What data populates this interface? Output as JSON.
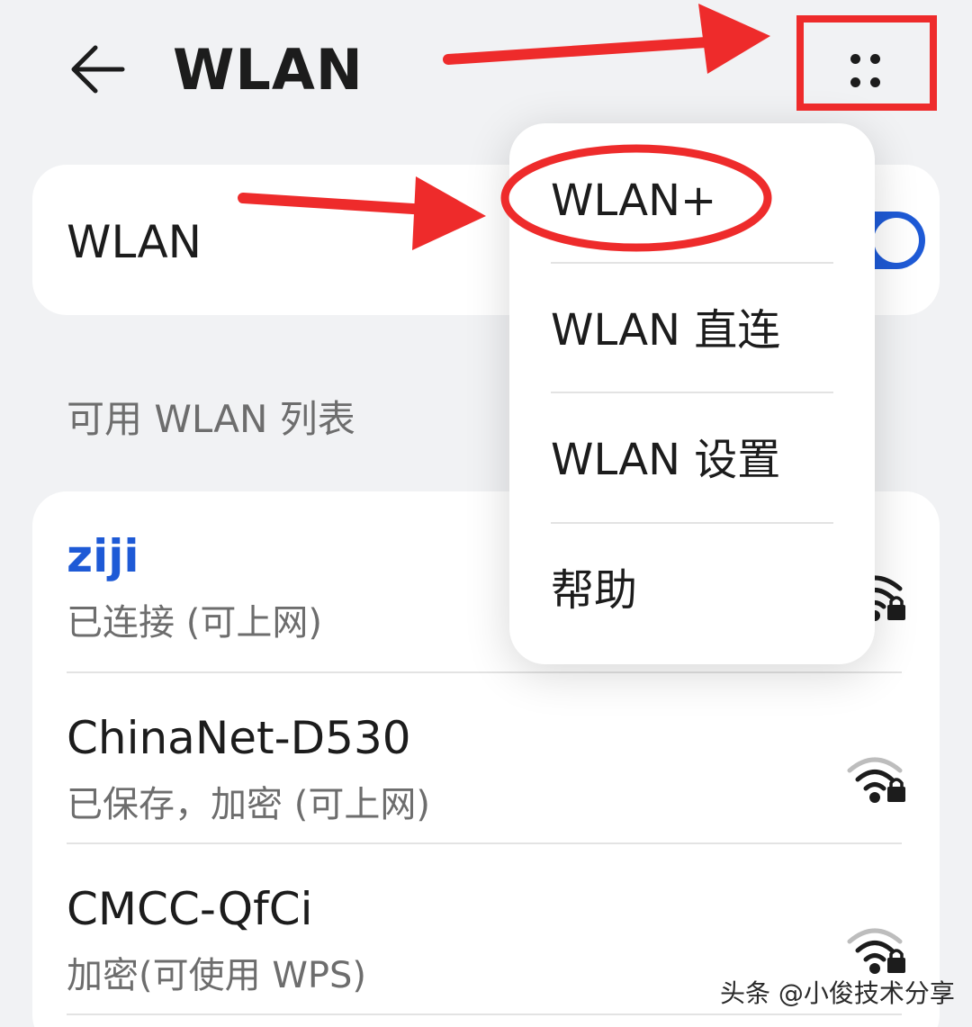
{
  "header": {
    "title": "WLAN",
    "back_icon": "arrow-left-icon",
    "more_icon": "more-dots-icon"
  },
  "wlan_switch": {
    "label": "WLAN",
    "enabled": true,
    "accent_color": "#1e5ad6"
  },
  "section": {
    "title": "可用 WLAN 列表"
  },
  "networks": [
    {
      "ssid": "ziji",
      "status": "已连接 (可上网)",
      "connected": true,
      "icon": "wifi-lock-icon"
    },
    {
      "ssid": "ChinaNet-D530",
      "status": "已保存，加密 (可上网)",
      "connected": false,
      "icon": "wifi-lock-icon"
    },
    {
      "ssid": "CMCC-QfCi",
      "status": "加密(可使用 WPS)",
      "connected": false,
      "icon": "wifi-lock-icon"
    }
  ],
  "menu": {
    "items": [
      {
        "label": "WLAN+"
      },
      {
        "label": "WLAN 直连"
      },
      {
        "label": "WLAN 设置"
      },
      {
        "label": "帮助"
      }
    ]
  },
  "annotations": {
    "color": "#ee2b2b"
  },
  "watermark": "头条 @小俊技术分享"
}
